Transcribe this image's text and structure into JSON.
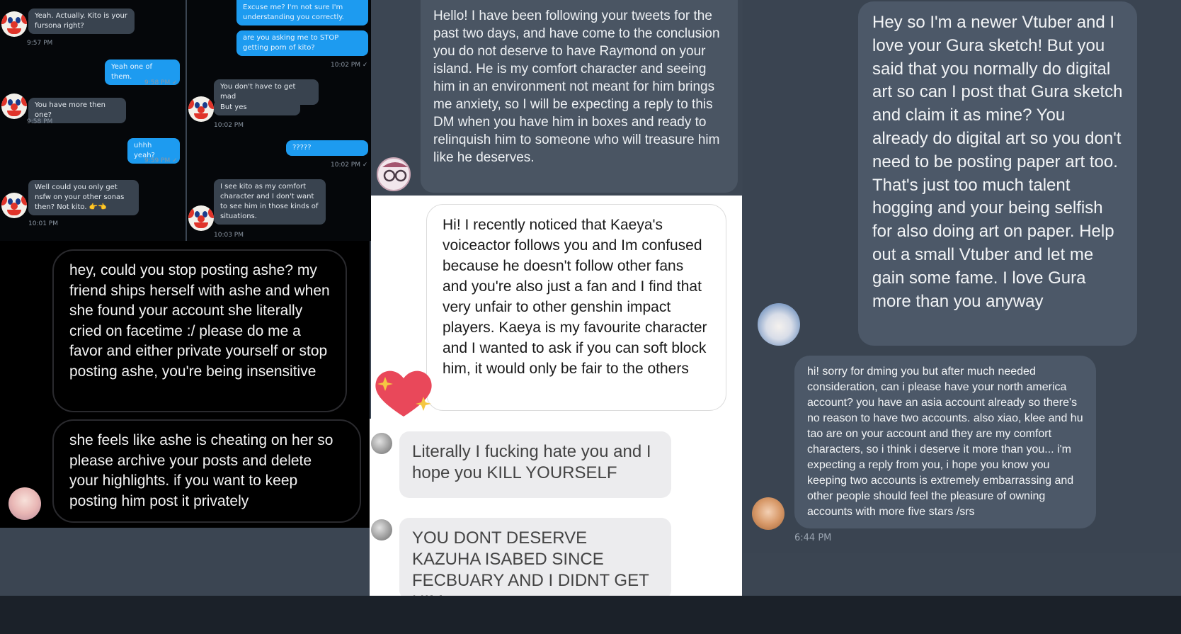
{
  "panel_a": {
    "left_col": {
      "m1": "Yeah. Actually. Kito is your fursona right?",
      "t1": "9:57 PM",
      "m2": "Yeah one of them.",
      "t2": "9:58 PM ✓",
      "m3": "You have more then one?",
      "t3": "9:58 PM",
      "m4": "uhhh yeah?",
      "t4": "9:59 PM ✓",
      "m5": "Well could you only get nsfw on your other sonas then? Not kito. 👉👈",
      "t5": "10:01 PM"
    },
    "right_col": {
      "m1": "Excuse me? I'm not sure I'm understanding you correctly.",
      "m2": "are you asking me to STOP getting porn of kito?",
      "t1": "10:02 PM ✓",
      "m3": "You don't have to get mad",
      "m4": "But yes",
      "t2": "10:02 PM",
      "m5": "?????",
      "t3": "10:02 PM ✓",
      "m6": "I see kito as my comfort character and I don't want to see him in those kinds of situations.",
      "t4": "10:03 PM"
    }
  },
  "panel_b": {
    "m1": "hey, could you stop posting ashe? my friend ships herself with ashe and when she found your account she literally cried on facetime :/ please do me a favor and either private yourself or stop posting ashe, you're being insensitive",
    "m2": "she feels like ashe is cheating on her so please archive your posts and delete your highlights. if you want to keep posting him post it privately"
  },
  "panel_c": {
    "m1": "Hello! I have been following your tweets for the past two days, and have come to the conclusion you do not deserve to have Raymond on your island. He is my comfort character and seeing him in an environment not meant for him brings me anxiety, so I will be expecting a reply to this DM when you have him in boxes and ready to relinquish him to someone who will treasure him like he deserves."
  },
  "panel_d": {
    "m1": "Hi! I recently noticed that Kaeya's voiceactor follows you and Im confused because he doesn't follow other fans and you're also just a fan and I find that very unfair to other genshin impact players. Kaeya is my favourite character and I wanted to ask if you can soft block him, it would only be fair to the others"
  },
  "panel_e": {
    "m1": "Literally I fucking hate you and I hope you KILL YOURSELF",
    "m2": "YOU DONT DESERVE KAZUHA ISABED SINCE FECBUARY AND I DIDNT GET HIM"
  },
  "panel_f": {
    "m1": "Hey so I'm a newer Vtuber and I love your Gura sketch! But you said that you normally do digital art so can I post that Gura sketch and claim it as mine? You already do digital art so you don't need to be posting paper art too. That's just too much talent hogging and your being selfish for also doing art on paper. Help out a small Vtuber and let me gain some fame. I love Gura more than you anyway",
    "m2": "hi! sorry for dming you but after much needed consideration, can i please have your north america account? you have an asia account already so there's no reason to have two accounts. also xiao, klee and hu tao are on your account and they are my comfort characters, so i think i deserve it more than you... i'm expecting a reply from you, i hope you know you keeping two accounts is extremely embarrassing and other people should feel the pleasure of owning accounts with more five stars /srs",
    "t2": "6:44 PM"
  },
  "colors": {
    "outgoing_blue": "#1d9bf0",
    "incoming_dark": "#39434f",
    "slate_bg": "#3c4653"
  }
}
